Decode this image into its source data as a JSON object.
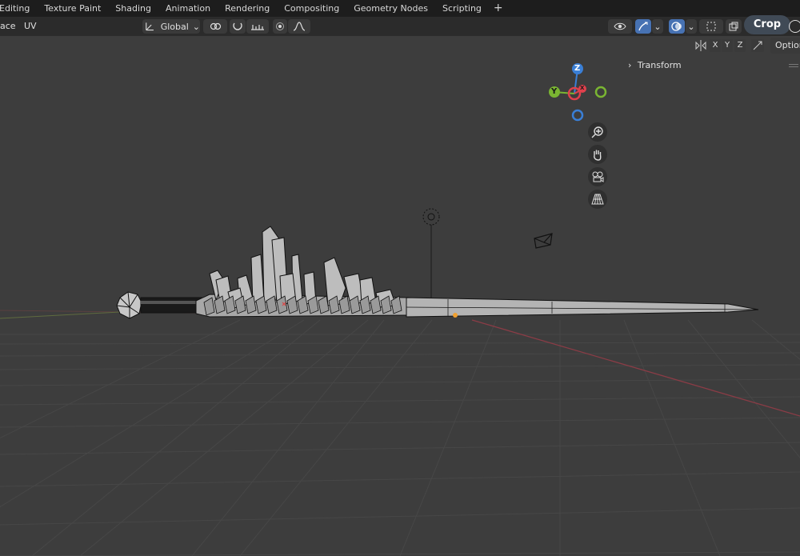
{
  "workspace_tabs": [
    "Editing",
    "Texture Paint",
    "Shading",
    "Animation",
    "Rendering",
    "Compositing",
    "Geometry Nodes",
    "Scripting"
  ],
  "header": {
    "face_label": "ace",
    "uv_label": "UV",
    "orientation_label": "Global",
    "crop_label": "Crop",
    "options_label": "Option"
  },
  "axis_locks": [
    "X",
    "Y",
    "Z"
  ],
  "sidebar": {
    "transform_label": "Transform"
  },
  "gizmo": {
    "z_label": "Z",
    "y_label": "Y",
    "x_label": "X"
  },
  "colors": {
    "x_axis": "#e0404c",
    "y_axis": "#7ab532",
    "z_axis": "#3a7fd6",
    "header_bg": "#2b2b2b",
    "topbar_bg": "#1d1d1d",
    "viewport_bg": "#3d3d3d",
    "accent": "#4772b3"
  },
  "icons": [
    "transform-orientation-icon",
    "snap-icon",
    "proportional-edit-icon",
    "visibility-icon",
    "gizmo-icon",
    "overlay-icon",
    "xray-icon",
    "zoom-icon",
    "pan-hand-icon",
    "camera-icon",
    "perspective-grid-icon",
    "light-icon",
    "camera-object-icon"
  ]
}
